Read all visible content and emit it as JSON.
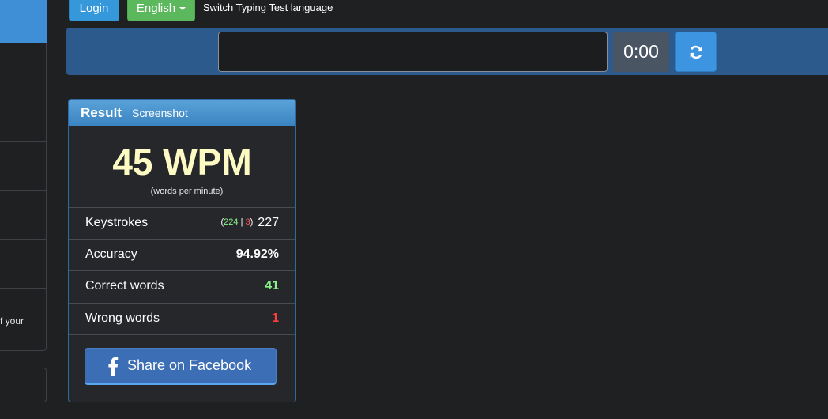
{
  "header": {
    "login_label": "Login",
    "language_label": "English",
    "switch_language_text": "Switch Typing Test language"
  },
  "sidebar": {
    "partial_text": "f your"
  },
  "typing": {
    "timer": "0:00",
    "input_value": ""
  },
  "result": {
    "title": "Result",
    "screenshot_tab": "Screenshot",
    "wpm": "45 WPM",
    "wpm_caption": "(words per minute)",
    "keystrokes_label": "Keystrokes",
    "keystrokes_open": "(",
    "keystrokes_correct": "224",
    "keystrokes_sep": " | ",
    "keystrokes_wrong": "3",
    "keystrokes_close": ")",
    "keystrokes_total": "227",
    "accuracy_label": "Accuracy",
    "accuracy_value": "94.92%",
    "correct_words_label": "Correct words",
    "correct_words_value": "41",
    "wrong_words_label": "Wrong words",
    "wrong_words_value": "1",
    "share_label": "Share on Facebook"
  },
  "colors": {
    "accent": "#3498db",
    "success": "#5cb85c",
    "wpm_text": "#fefac4",
    "correct": "#8af48a",
    "wrong": "#ff3d3d",
    "facebook": "#3b6eb5"
  },
  "icons": {
    "refresh": "refresh-icon",
    "facebook": "facebook-icon",
    "caret": "caret-down-icon"
  }
}
